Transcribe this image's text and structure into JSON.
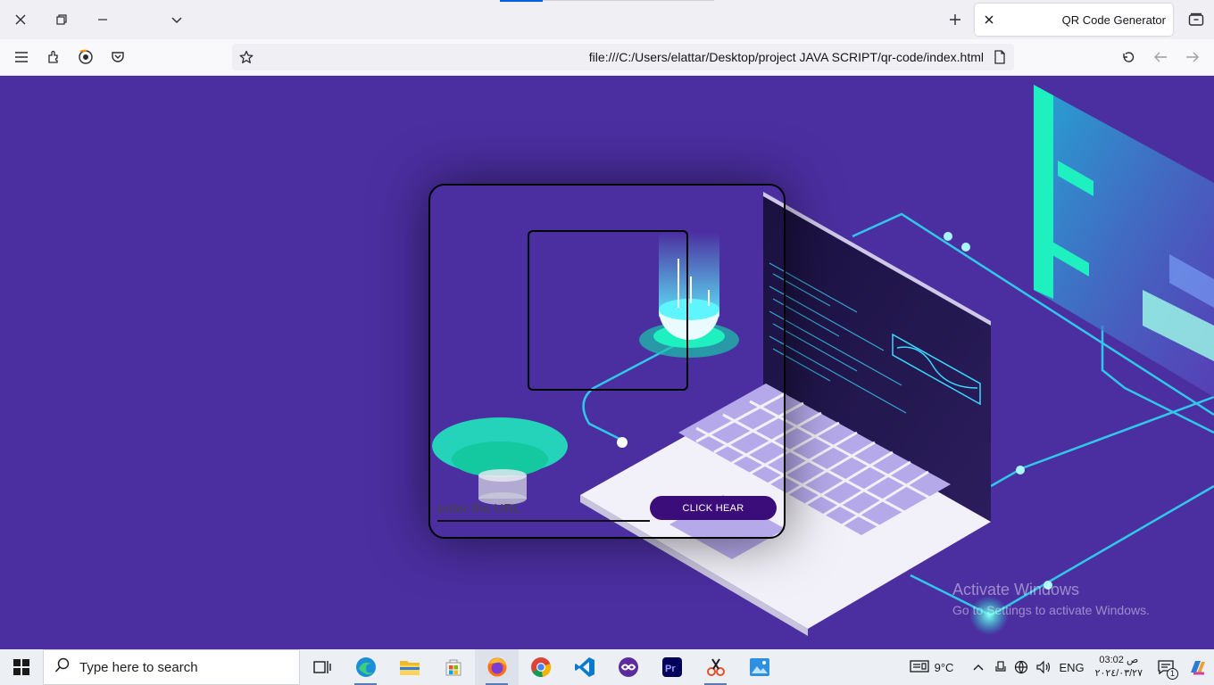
{
  "browser": {
    "tab_title": "QR Code Generator",
    "url": "file:///C:/Users/elattar/Desktop/project JAVA SCRIPT/qr-code/index.html"
  },
  "app": {
    "input_placeholder": "enter the URL",
    "button_label": "CLICK HEAR"
  },
  "watermark": {
    "line1": "Activate Windows",
    "line2": "Go to Settings to activate Windows."
  },
  "taskbar": {
    "search_placeholder": "Type here to search",
    "apps": [
      "task-view",
      "edge",
      "file-explorer",
      "microsoft-store",
      "firefox",
      "chrome",
      "vs-code",
      "game-app",
      "premiere-pro",
      "snipping-tool",
      "photos"
    ],
    "active_app": "firefox",
    "weather": "9°C",
    "language": "ENG",
    "time": "03:02 ص",
    "date": "٢٠٢٤/٠٣/٢٧",
    "notification_count": "1"
  },
  "colors": {
    "page_bg": "#4b2ea0",
    "button_bg": "#3a0d7a",
    "accent": "#19e6d0"
  }
}
